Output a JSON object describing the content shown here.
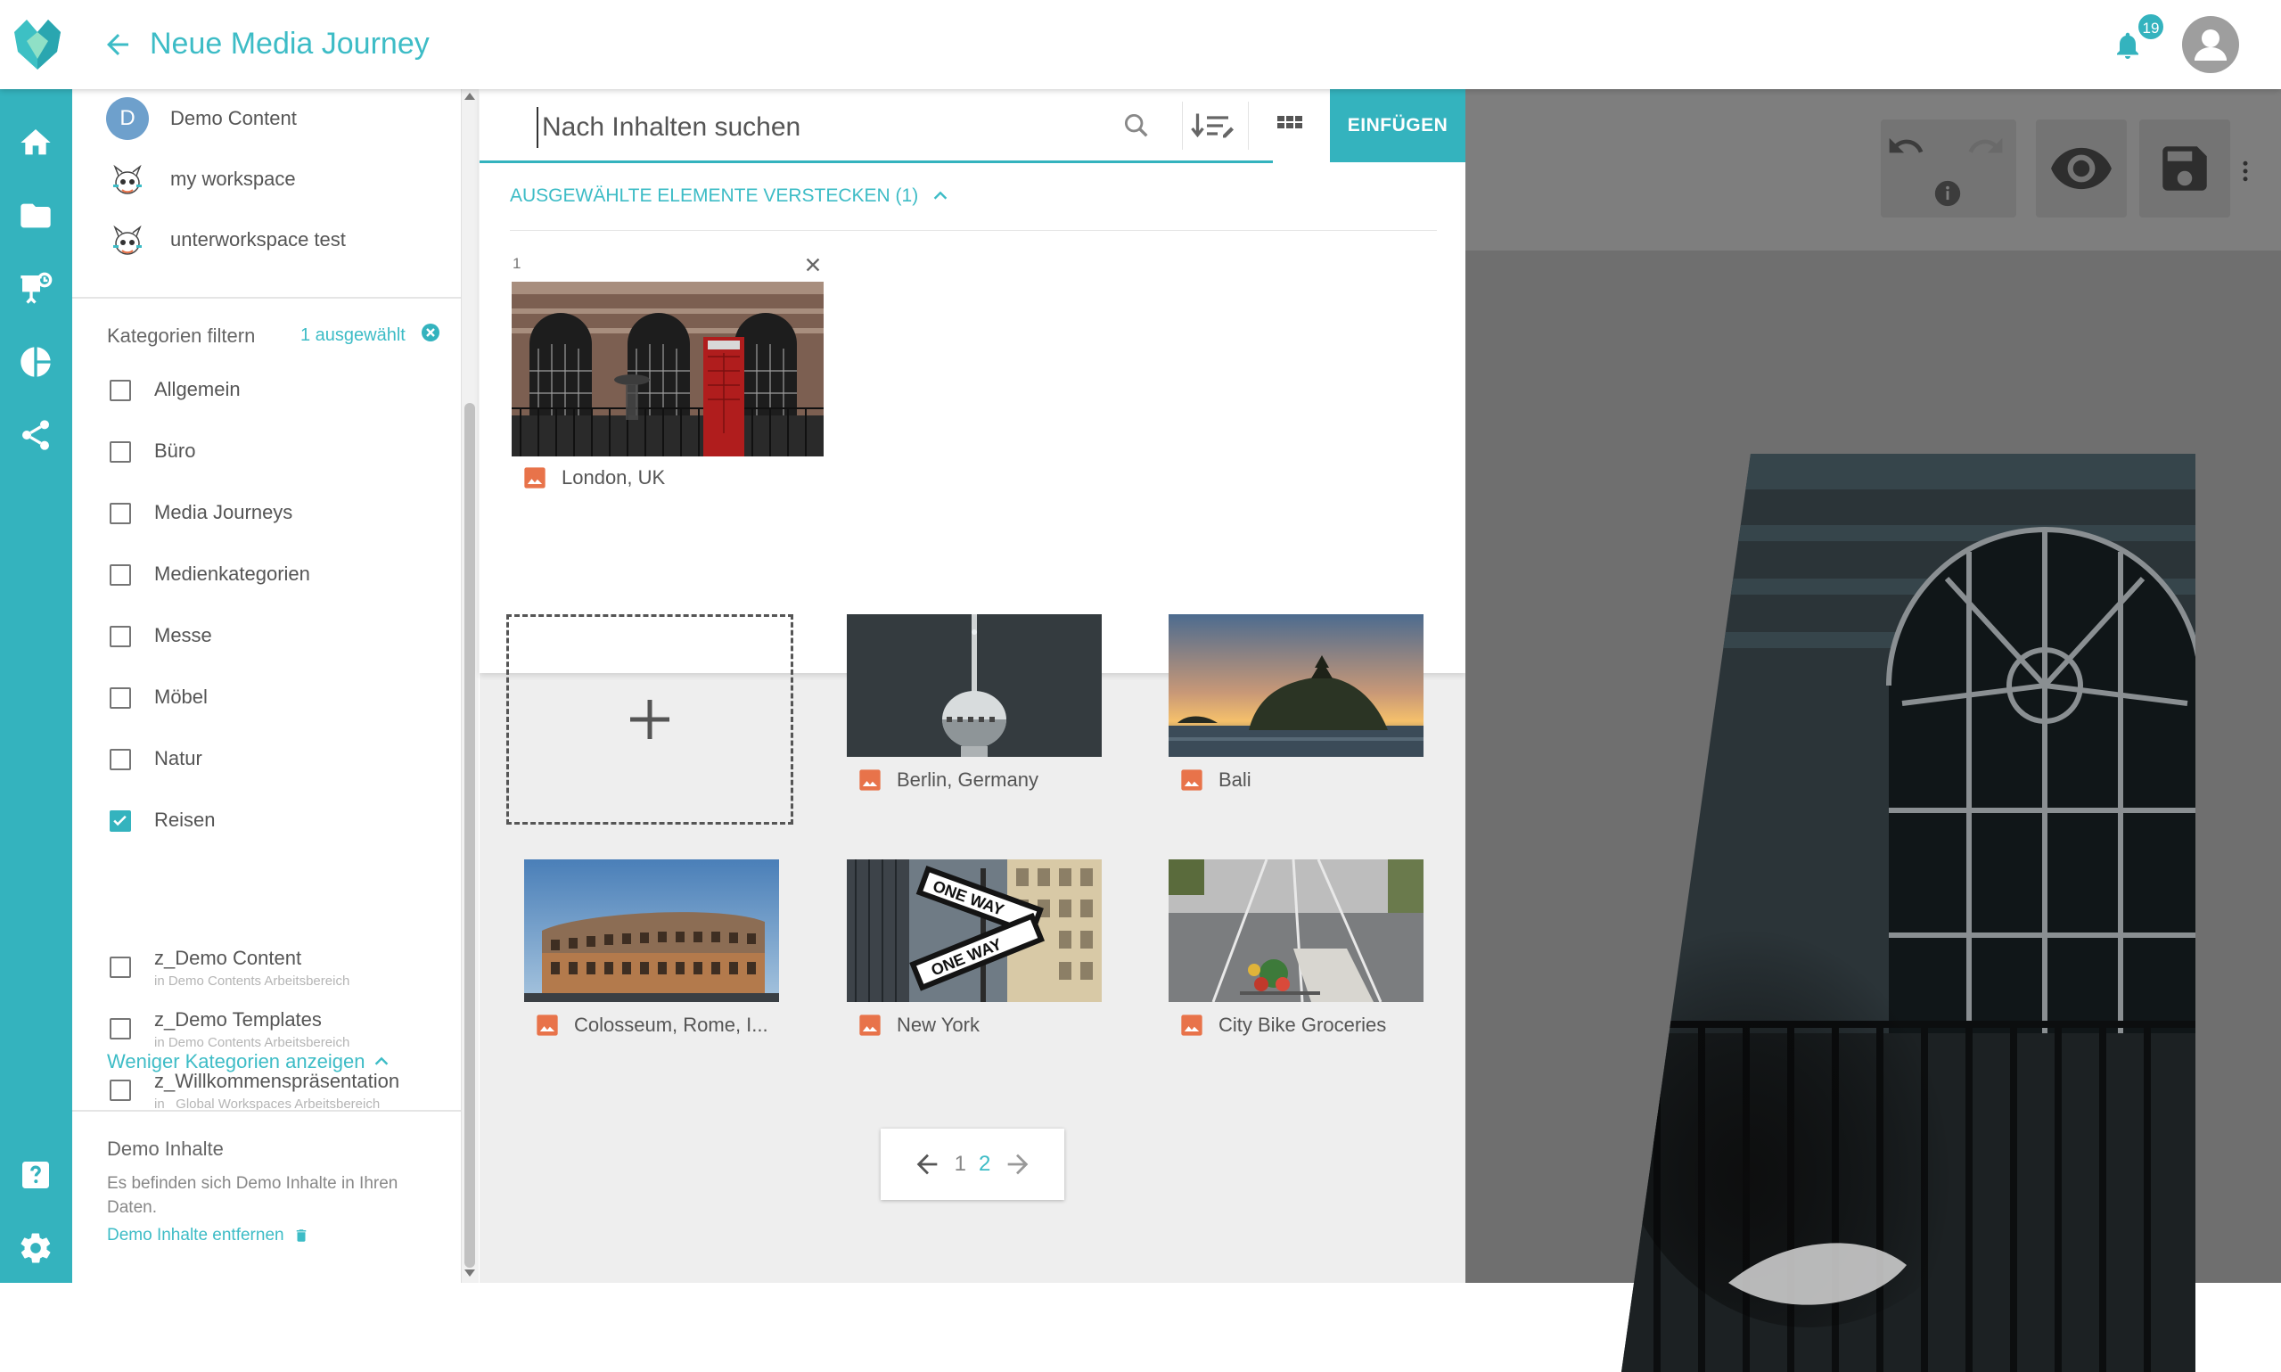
{
  "header": {
    "title": "Neue Media Journey",
    "notification_count": "19"
  },
  "colors": {
    "accent": "#34b3be",
    "accent_text": "#3dbcc6",
    "image_icon": "#e8734a"
  },
  "nav": {
    "items": [
      "home-icon",
      "folder-icon",
      "presentation-icon",
      "chart-icon",
      "share-icon"
    ],
    "bottom": [
      "help-icon",
      "settings-icon"
    ]
  },
  "workspaces": [
    {
      "avatar": "D",
      "label": "Demo Content"
    },
    {
      "avatar": "mascot",
      "label": "my workspace"
    },
    {
      "avatar": "mascot",
      "label": "unterworkspace test"
    }
  ],
  "categories": {
    "header": "Kategorien filtern",
    "selected": "1 ausgewählt",
    "items": [
      {
        "label": "Allgemein",
        "checked": false
      },
      {
        "label": "Büro",
        "checked": false
      },
      {
        "label": "Media Journeys",
        "checked": false
      },
      {
        "label": "Medienkategorien",
        "checked": false,
        "expandable": true
      },
      {
        "label": "Messe",
        "checked": false
      },
      {
        "label": "Möbel",
        "checked": false
      },
      {
        "label": "Natur",
        "checked": false
      },
      {
        "label": "Reisen",
        "checked": true
      },
      {
        "label": "z_Demo Content",
        "sub": "in Demo Contents Arbeitsbereich",
        "checked": false,
        "expandable": true
      },
      {
        "label": "z_Demo Templates",
        "sub": "in Demo Contents Arbeitsbereich",
        "checked": false
      },
      {
        "label": "z_Willkommenspräsentation",
        "sub": "in _Global Workspaces Arbeitsbereich",
        "checked": false
      }
    ],
    "less_link": "Weniger Kategorien anzeigen"
  },
  "demo": {
    "title": "Demo Inhalte",
    "text": "Es befinden sich Demo Inhalte in Ihren Daten.",
    "remove": "Demo Inhalte entfernen"
  },
  "search": {
    "placeholder": "Nach Inhalten suchen",
    "insert_label": "EINFÜGEN"
  },
  "selection": {
    "toggle": "AUSGEWÄHLTE ELEMENTE VERSTECKEN (1)",
    "index": "1",
    "item": "London, UK"
  },
  "results": [
    {
      "label": "Berlin, Germany"
    },
    {
      "label": "Bali"
    },
    {
      "label": "Colosseum, Rome, I..."
    },
    {
      "label": "New York"
    },
    {
      "label": "City Bike Groceries"
    }
  ],
  "pagination": {
    "pages": [
      "1",
      "2"
    ],
    "current": "2"
  }
}
